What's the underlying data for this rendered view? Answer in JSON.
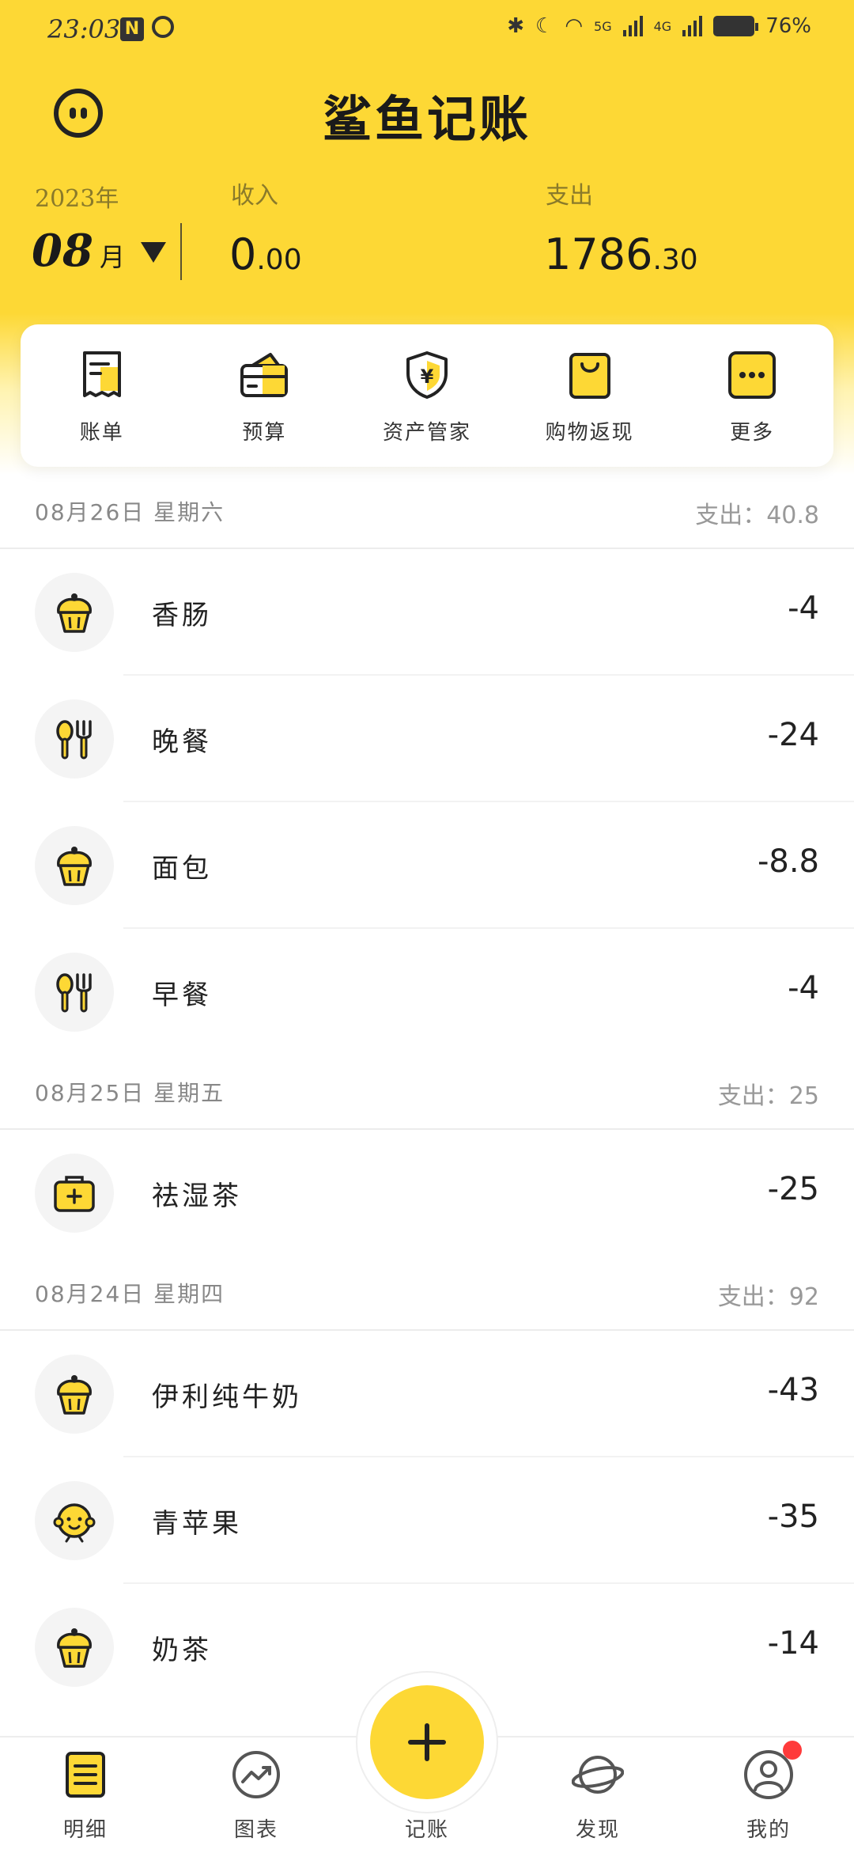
{
  "status_bar": {
    "time": "23:03",
    "signal_1": "5G",
    "signal_2": "4G",
    "battery": "76%"
  },
  "header": {
    "app_title": "鲨鱼记账",
    "year": "2023年",
    "month_num": "08",
    "month_unit": "月",
    "income_label": "收入",
    "income_int": "0",
    "income_dec": ".00",
    "expense_label": "支出",
    "expense_int": "1786",
    "expense_dec": ".30"
  },
  "quick_actions": [
    {
      "label": "账单",
      "icon": "bill-icon"
    },
    {
      "label": "预算",
      "icon": "wallet-icon"
    },
    {
      "label": "资产管家",
      "icon": "shield-yen-icon"
    },
    {
      "label": "购物返现",
      "icon": "shopping-bag-icon"
    },
    {
      "label": "更多",
      "icon": "more-icon"
    }
  ],
  "days": [
    {
      "date": "08月26日 星期六",
      "total": "支出：40.8",
      "items": [
        {
          "name": "香肠",
          "amount": "-4",
          "icon": "cupcake-icon"
        },
        {
          "name": "晚餐",
          "amount": "-24",
          "icon": "spoon-fork-icon"
        },
        {
          "name": "面包",
          "amount": "-8.8",
          "icon": "cupcake-icon"
        },
        {
          "name": "早餐",
          "amount": "-4",
          "icon": "spoon-fork-icon"
        }
      ]
    },
    {
      "date": "08月25日 星期五",
      "total": "支出：25",
      "items": [
        {
          "name": "祛湿茶",
          "amount": "-25",
          "icon": "medical-kit-icon"
        }
      ]
    },
    {
      "date": "08月24日 星期四",
      "total": "支出：92",
      "items": [
        {
          "name": "伊利纯牛奶",
          "amount": "-43",
          "icon": "cupcake-icon"
        },
        {
          "name": "青苹果",
          "amount": "-35",
          "icon": "baby-face-icon"
        },
        {
          "name": "奶茶",
          "amount": "-14",
          "icon": "cupcake-icon"
        }
      ]
    }
  ],
  "bottom_nav": [
    {
      "label": "明细",
      "icon": "detail-list-icon"
    },
    {
      "label": "图表",
      "icon": "chart-trend-icon"
    },
    {
      "label": "记账",
      "icon": "plus-icon"
    },
    {
      "label": "发现",
      "icon": "planet-icon"
    },
    {
      "label": "我的",
      "icon": "profile-icon"
    }
  ],
  "colors": {
    "accent": "#FDD835",
    "text": "#222222",
    "muted": "#999999",
    "badge": "#FF3B3B"
  }
}
